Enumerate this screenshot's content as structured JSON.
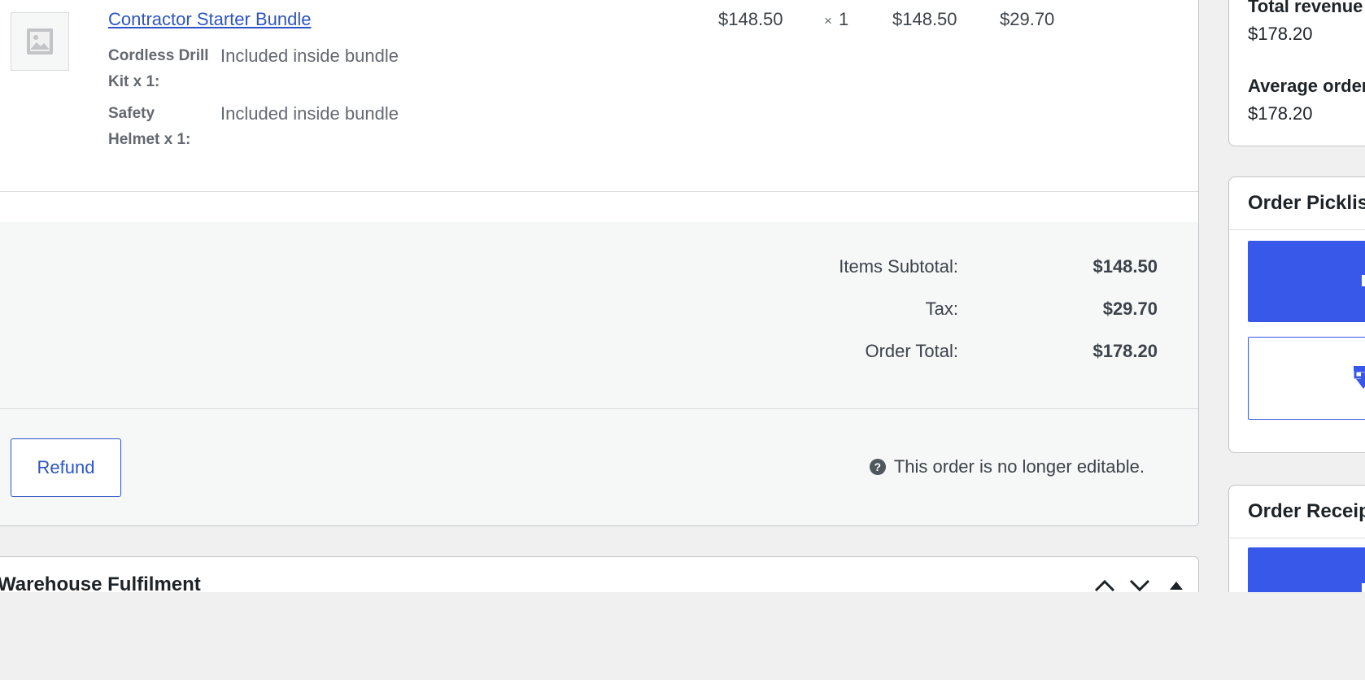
{
  "order_item": {
    "name": "Contractor Starter Bundle",
    "meta": [
      {
        "key_line1": "Cordless Drill",
        "key_line2": "Kit x 1:",
        "value": "Included inside bundle"
      },
      {
        "key_line1": "Safety",
        "key_line2": "Helmet x 1:",
        "value": "Included inside bundle"
      }
    ],
    "cost": "$148.50",
    "qty_symbol": "×",
    "qty": "1",
    "total": "$148.50",
    "tax": "$29.70"
  },
  "totals": {
    "subtotal_label": "Items Subtotal:",
    "subtotal_value": "$148.50",
    "tax_label": "Tax:",
    "tax_value": "$29.70",
    "order_total_label": "Order Total:",
    "order_total_value": "$178.20"
  },
  "actions": {
    "refund_label": "Refund",
    "help_glyph": "?",
    "not_editable_text": "This order is no longer editable."
  },
  "warehouse": {
    "title": "Warehouse Fulfilment"
  },
  "sidebar": {
    "stats": {
      "total_revenue_label": "Total revenue",
      "total_revenue_value": "$178.20",
      "average_order_label": "Average order",
      "average_order_value": "$178.20"
    },
    "picklist_title": "Order Picklist",
    "receipt_title": "Order Receipt",
    "accent_color": "#3858e9"
  },
  "icons": {
    "thumbnail": "image-placeholder-icon",
    "help": "help-icon",
    "move_up": "chevron-up-icon",
    "move_down": "chevron-down-icon",
    "toggle": "triangle-up-icon",
    "download": "download-icon"
  }
}
